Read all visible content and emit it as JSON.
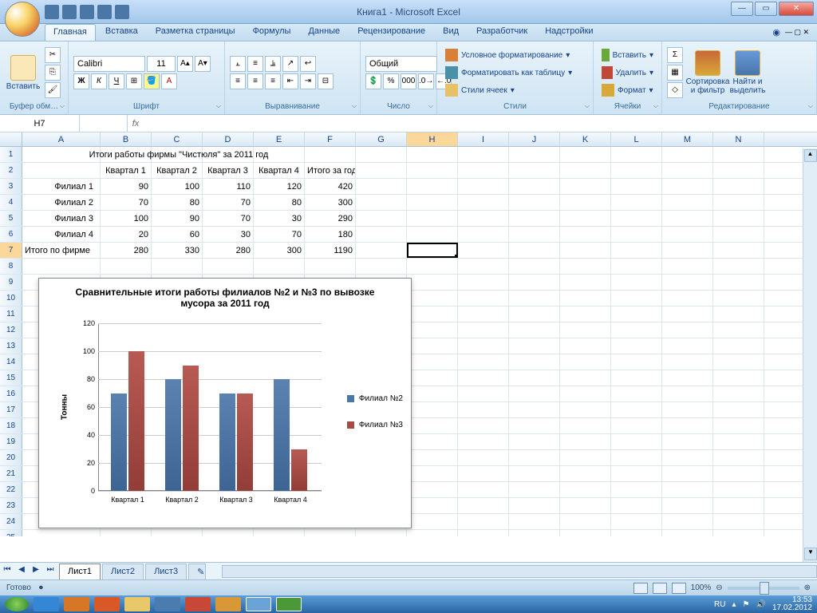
{
  "title": "Книга1 - Microsoft Excel",
  "tabs": [
    "Главная",
    "Вставка",
    "Разметка страницы",
    "Формулы",
    "Данные",
    "Рецензирование",
    "Вид",
    "Разработчик",
    "Надстройки"
  ],
  "ribbon": {
    "clipboard": {
      "paste": "Вставить",
      "label": "Буфер обм…"
    },
    "font": {
      "name": "Calibri",
      "size": "11",
      "label": "Шрифт",
      "bold": "Ж",
      "italic": "К",
      "underline": "Ч"
    },
    "align": {
      "label": "Выравнивание"
    },
    "number": {
      "fmt": "Общий",
      "label": "Число"
    },
    "styles": {
      "cond": "Условное форматирование",
      "table": "Форматировать как таблицу",
      "cell": "Стили ячеек",
      "label": "Стили"
    },
    "cells": {
      "ins": "Вставить",
      "del": "Удалить",
      "fmt": "Формат",
      "label": "Ячейки"
    },
    "editing": {
      "sort": "Сортировка\nи фильтр",
      "find": "Найти и\nвыделить",
      "label": "Редактирование"
    }
  },
  "namebox": "H7",
  "cols": [
    "A",
    "B",
    "C",
    "D",
    "E",
    "F",
    "G",
    "H",
    "I",
    "J",
    "K",
    "L",
    "M",
    "N"
  ],
  "data_title": "Итоги работы фирмы \"Чистюля\" за 2011 год",
  "headers": [
    "Квартал 1",
    "Квартал 2",
    "Квартал 3",
    "Квартал 4",
    "Итого за год"
  ],
  "rows": [
    {
      "l": "Филиал 1",
      "v": [
        90,
        100,
        110,
        120,
        420
      ]
    },
    {
      "l": "Филиал 2",
      "v": [
        70,
        80,
        70,
        80,
        300
      ]
    },
    {
      "l": "Филиал 3",
      "v": [
        100,
        90,
        70,
        30,
        290
      ]
    },
    {
      "l": "Филиал 4",
      "v": [
        20,
        60,
        30,
        70,
        180
      ]
    },
    {
      "l": "Итого по фирме",
      "v": [
        280,
        330,
        280,
        300,
        1190
      ]
    }
  ],
  "chart_data": {
    "type": "bar",
    "title": "Сравнительные итоги работы филиалов №2 и №3 по вывозке мусора за 2011 год",
    "ylabel": "Тонны",
    "categories": [
      "Квартал 1",
      "Квартал 2",
      "Квартал 3",
      "Квартал 4"
    ],
    "series": [
      {
        "name": "Филиал №2",
        "values": [
          70,
          80,
          70,
          80
        ],
        "color": "#4a76a8"
      },
      {
        "name": "Филиал №3",
        "values": [
          100,
          90,
          70,
          30
        ],
        "color": "#a84a44"
      }
    ],
    "ylim": [
      0,
      120
    ],
    "yticks": [
      0,
      20,
      40,
      60,
      80,
      100,
      120
    ]
  },
  "sheets": [
    "Лист1",
    "Лист2",
    "Лист3"
  ],
  "status": "Готово",
  "zoom": "100%",
  "lang": "RU",
  "time": "13:53",
  "date": "17.02.2012"
}
